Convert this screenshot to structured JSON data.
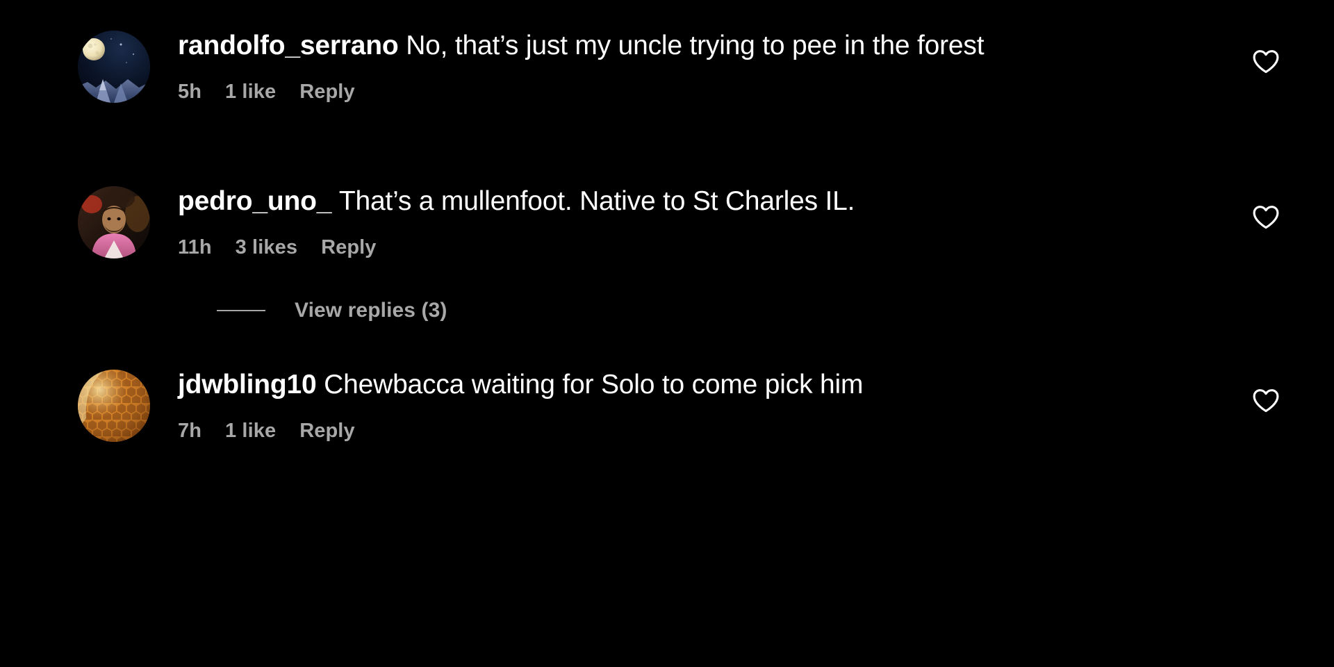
{
  "theme": {
    "background": "#000000",
    "text_primary": "#ffffff",
    "text_secondary": "#a8a8a8"
  },
  "comments": [
    {
      "username": "randolfo_serrano",
      "message": "No, that’s just my uncle trying to pee in the forest",
      "timestamp": "5h",
      "likes": "1 like",
      "reply": "Reply",
      "like_icon": "heart-outline-icon",
      "avatar": "night-sky-moon-avatar"
    },
    {
      "username": "pedro_uno_",
      "message": "That’s a mullenfoot. Native to St Charles IL.",
      "timestamp": "11h",
      "likes": "3 likes",
      "reply": "Reply",
      "like_icon": "heart-outline-icon",
      "avatar": "person-pink-shirt-avatar"
    },
    {
      "username": "jdwbling10",
      "message": "Chewbacca waiting for Solo to come pick him",
      "timestamp": "7h",
      "likes": "1 like",
      "reply": "Reply",
      "like_icon": "heart-outline-icon",
      "avatar": "honeycomb-avatar"
    }
  ],
  "view_replies": {
    "label": "View replies (3)"
  }
}
